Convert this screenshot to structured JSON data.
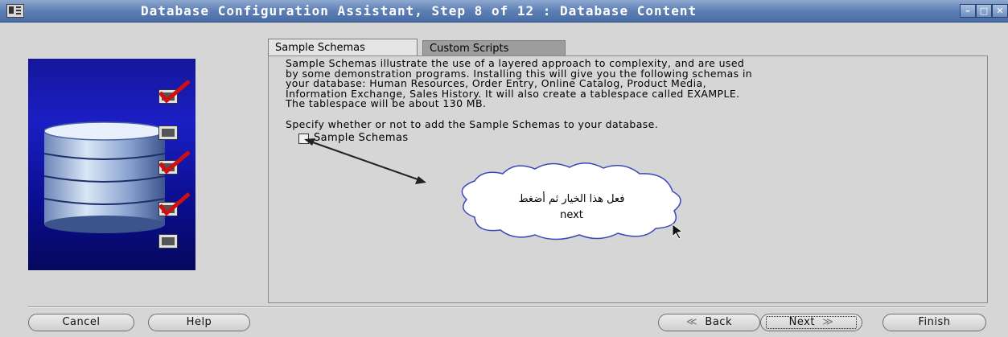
{
  "window": {
    "title": "Database Configuration Assistant, Step 8 of 12 : Database Content",
    "controls": [
      "minimize",
      "maximize",
      "close"
    ]
  },
  "tabs": [
    {
      "label": "Sample Schemas",
      "active": true
    },
    {
      "label": "Custom Scripts",
      "active": false
    }
  ],
  "content": {
    "description_lines": [
      "Sample Schemas illustrate the use of a layered approach to complexity, and are used",
      "by some demonstration programs. Installing this will give you the following schemas in",
      "your database: Human Resources, Order Entry, Online Catalog, Product Media,",
      "Information Exchange, Sales History. It will also create a tablespace called EXAMPLE.",
      "The tablespace will be about 130 MB."
    ],
    "specify_text": "Specify whether or not to add the Sample Schemas to your database.",
    "checkbox": {
      "label": "Sample Schemas",
      "checked": false
    }
  },
  "callout": {
    "line1": "فعل هذا الخيار ثم أضغط",
    "line2": "next"
  },
  "buttons": {
    "cancel": "Cancel",
    "help": "Help",
    "back": "Back",
    "next": "Next",
    "finish": "Finish"
  },
  "colors": {
    "titlebar": "#5d7fb4",
    "graphic_bg": "#1b1fc4",
    "check_red": "#d01010"
  }
}
